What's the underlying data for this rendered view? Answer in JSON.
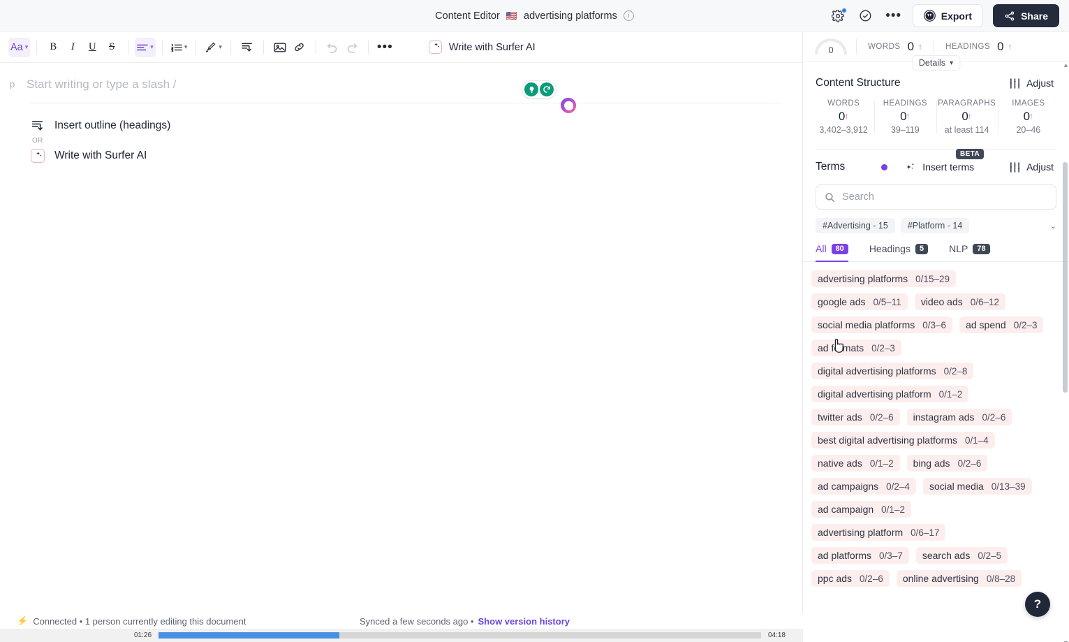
{
  "topbar": {
    "title": "Content Editor",
    "flag": "🇺🇸",
    "keyword": "advertising platforms",
    "info_icon": "info-icon",
    "settings_icon": "gear-icon",
    "check_icon": "check-circle-icon",
    "more_icon": "more-horizontal-icon",
    "export_label": "Export",
    "export_icon": "wordpress-icon",
    "share_label": "Share",
    "share_icon": "share-icon"
  },
  "toolbar": {
    "font_label": "Aa",
    "bold_label": "B",
    "italic_label": "I",
    "underline_label": "U",
    "strike_label": "S",
    "align_icon": "align-left-icon",
    "list_icon": "ordered-list-icon",
    "highlight_icon": "brush-icon",
    "indent_icon": "indent-icon",
    "image_icon": "image-icon",
    "link_icon": "link-icon",
    "undo_icon": "undo-icon",
    "redo_icon": "redo-icon",
    "more_icon": "more-horizontal-icon",
    "surfer_ai_label": "Write with Surfer AI"
  },
  "editor": {
    "paragraph_mark": "p",
    "placeholder": "Start writing or type a slash /",
    "outline_option": "Insert outline (headings)",
    "or_label": "OR",
    "surfer_option": "Write with Surfer AI",
    "grammarly_idea_icon": "lightbulb-icon",
    "grammarly_refresh_icon": "refresh-icon"
  },
  "status": {
    "connected": "Connected • 1 person currently editing this document",
    "synced": "Synced a few seconds ago •",
    "version_history": "Show version history"
  },
  "video": {
    "current_time": "01:26",
    "total_time": "04:18",
    "progress_percent": 30
  },
  "panel": {
    "score": "0",
    "top_metrics": [
      {
        "label": "WORDS",
        "value": "0",
        "trend": "↑"
      },
      {
        "label": "HEADINGS",
        "value": "0",
        "trend": "↑"
      }
    ],
    "details_label": "Details",
    "content_structure": {
      "title": "Content Structure",
      "adjust_label": "Adjust",
      "adjust_icon": "sliders-icon",
      "cells": [
        {
          "label": "WORDS",
          "value": "0",
          "trend": "↑",
          "range": "3,402–3,912"
        },
        {
          "label": "HEADINGS",
          "value": "0",
          "trend": "↑",
          "range": "39–119"
        },
        {
          "label": "PARAGRAPHS",
          "value": "0",
          "trend": "↑",
          "range": "at least 114"
        },
        {
          "label": "IMAGES",
          "value": "0",
          "trend": "↑",
          "range": "20–46"
        }
      ]
    },
    "terms": {
      "title": "Terms",
      "insert_label": "Insert terms",
      "insert_icon": "sparkles-icon",
      "beta_label": "BETA",
      "adjust_label": "Adjust",
      "adjust_icon": "sliders-icon",
      "search_placeholder": "Search",
      "search_icon": "search-icon",
      "search_value": "",
      "tags": [
        "#Advertising - 15",
        "#Platform - 14"
      ],
      "tags_caret_icon": "chevron-down-icon",
      "tabs": [
        {
          "label": "All",
          "count": "80",
          "active": true
        },
        {
          "label": "Headings",
          "count": "5",
          "active": false
        },
        {
          "label": "NLP",
          "count": "78",
          "active": false
        }
      ],
      "items": [
        {
          "name": "advertising platforms",
          "count": "0/15–29"
        },
        {
          "name": "google ads",
          "count": "0/5–11"
        },
        {
          "name": "video ads",
          "count": "0/6–12"
        },
        {
          "name": "social media platforms",
          "count": "0/3–6"
        },
        {
          "name": "ad spend",
          "count": "0/2–3"
        },
        {
          "name": "ad formats",
          "count": "0/2–3"
        },
        {
          "name": "digital advertising platforms",
          "count": "0/2–8"
        },
        {
          "name": "digital advertising platform",
          "count": "0/1–2"
        },
        {
          "name": "twitter ads",
          "count": "0/2–6"
        },
        {
          "name": "instagram ads",
          "count": "0/2–6"
        },
        {
          "name": "best digital advertising platforms",
          "count": "0/1–4"
        },
        {
          "name": "native ads",
          "count": "0/1–2"
        },
        {
          "name": "bing ads",
          "count": "0/2–6"
        },
        {
          "name": "ad campaigns",
          "count": "0/2–4"
        },
        {
          "name": "social media",
          "count": "0/13–39"
        },
        {
          "name": "ad campaign",
          "count": "0/1–2"
        },
        {
          "name": "advertising platform",
          "count": "0/6–17"
        },
        {
          "name": "ad platforms",
          "count": "0/3–7"
        },
        {
          "name": "search ads",
          "count": "0/2–5"
        },
        {
          "name": "ppc ads",
          "count": "0/2–6"
        },
        {
          "name": "online advertising",
          "count": "0/8–28"
        }
      ]
    },
    "help_label": "?"
  },
  "colors": {
    "accent_purple": "#7b3fe4",
    "term_bg": "#fdeeee",
    "share_dark": "#242b3d",
    "trend_red": "#e1607a",
    "progress_blue": "#4a90e2"
  }
}
